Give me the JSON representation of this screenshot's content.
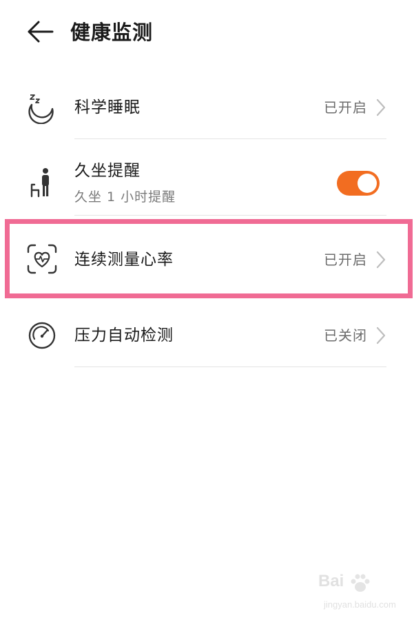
{
  "header": {
    "title": "健康监测",
    "back_icon": "arrow-left-icon"
  },
  "items": [
    {
      "title": "科学睡眠",
      "status": "已开启",
      "icon": "sleep-moon-icon"
    },
    {
      "title": "久坐提醒",
      "subtitle": "久坐 1 小时提醒",
      "icon": "sedentary-person-icon",
      "toggle_on": true,
      "toggle_color": "#f26d21"
    },
    {
      "title": "连续测量心率",
      "status": "已开启",
      "icon": "heart-rate-scan-icon"
    },
    {
      "title": "压力自动检测",
      "status": "已关闭",
      "icon": "pressure-gauge-icon"
    }
  ],
  "highlight_color": "#f06b94",
  "watermark": {
    "line1": "Bai",
    "line2": "jingyan.baidu.com"
  }
}
